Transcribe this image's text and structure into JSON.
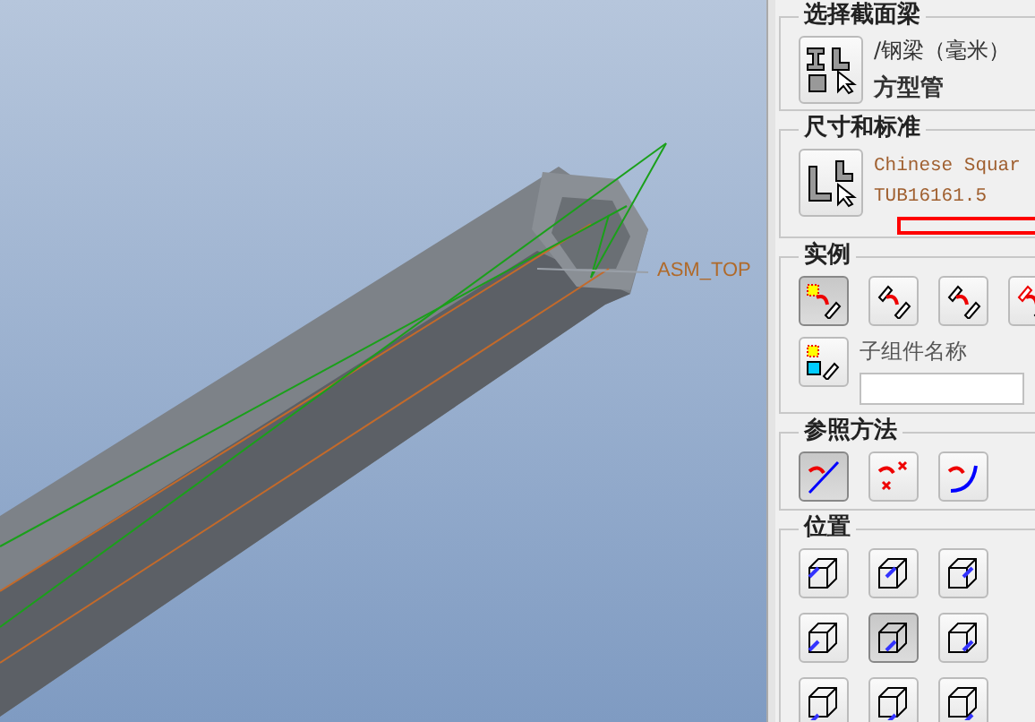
{
  "viewport": {
    "datum_label": "ASM_TOP"
  },
  "panel": {
    "section_group": {
      "title": "选择截面梁",
      "library": "/钢梁（毫米）",
      "profile": "方型管"
    },
    "size_group": {
      "title": "尺寸和标准",
      "standard": "Chinese Squar",
      "size": "TUB16161.5"
    },
    "instance_group": {
      "title": "实例",
      "buttons": [
        {
          "kind": "new",
          "selected": true
        },
        {
          "kind": "copy",
          "selected": false
        },
        {
          "kind": "move",
          "selected": false
        },
        {
          "kind": "partial",
          "selected": false
        }
      ],
      "subcomponent_label": "子组件名称"
    },
    "reference_group": {
      "title": "参照方法",
      "buttons": [
        {
          "kind": "line",
          "selected": true
        },
        {
          "kind": "points",
          "selected": false
        },
        {
          "kind": "curve",
          "selected": false
        }
      ]
    },
    "position_group": {
      "title": "位置",
      "buttons": [
        {
          "kind": "tl",
          "selected": false
        },
        {
          "kind": "tc",
          "selected": false
        },
        {
          "kind": "tr",
          "selected": false
        },
        {
          "kind": "ml",
          "selected": false
        },
        {
          "kind": "mc",
          "selected": true
        },
        {
          "kind": "mr",
          "selected": false
        },
        {
          "kind": "bl",
          "selected": false
        },
        {
          "kind": "bc",
          "selected": false
        },
        {
          "kind": "br",
          "selected": false
        }
      ]
    }
  }
}
